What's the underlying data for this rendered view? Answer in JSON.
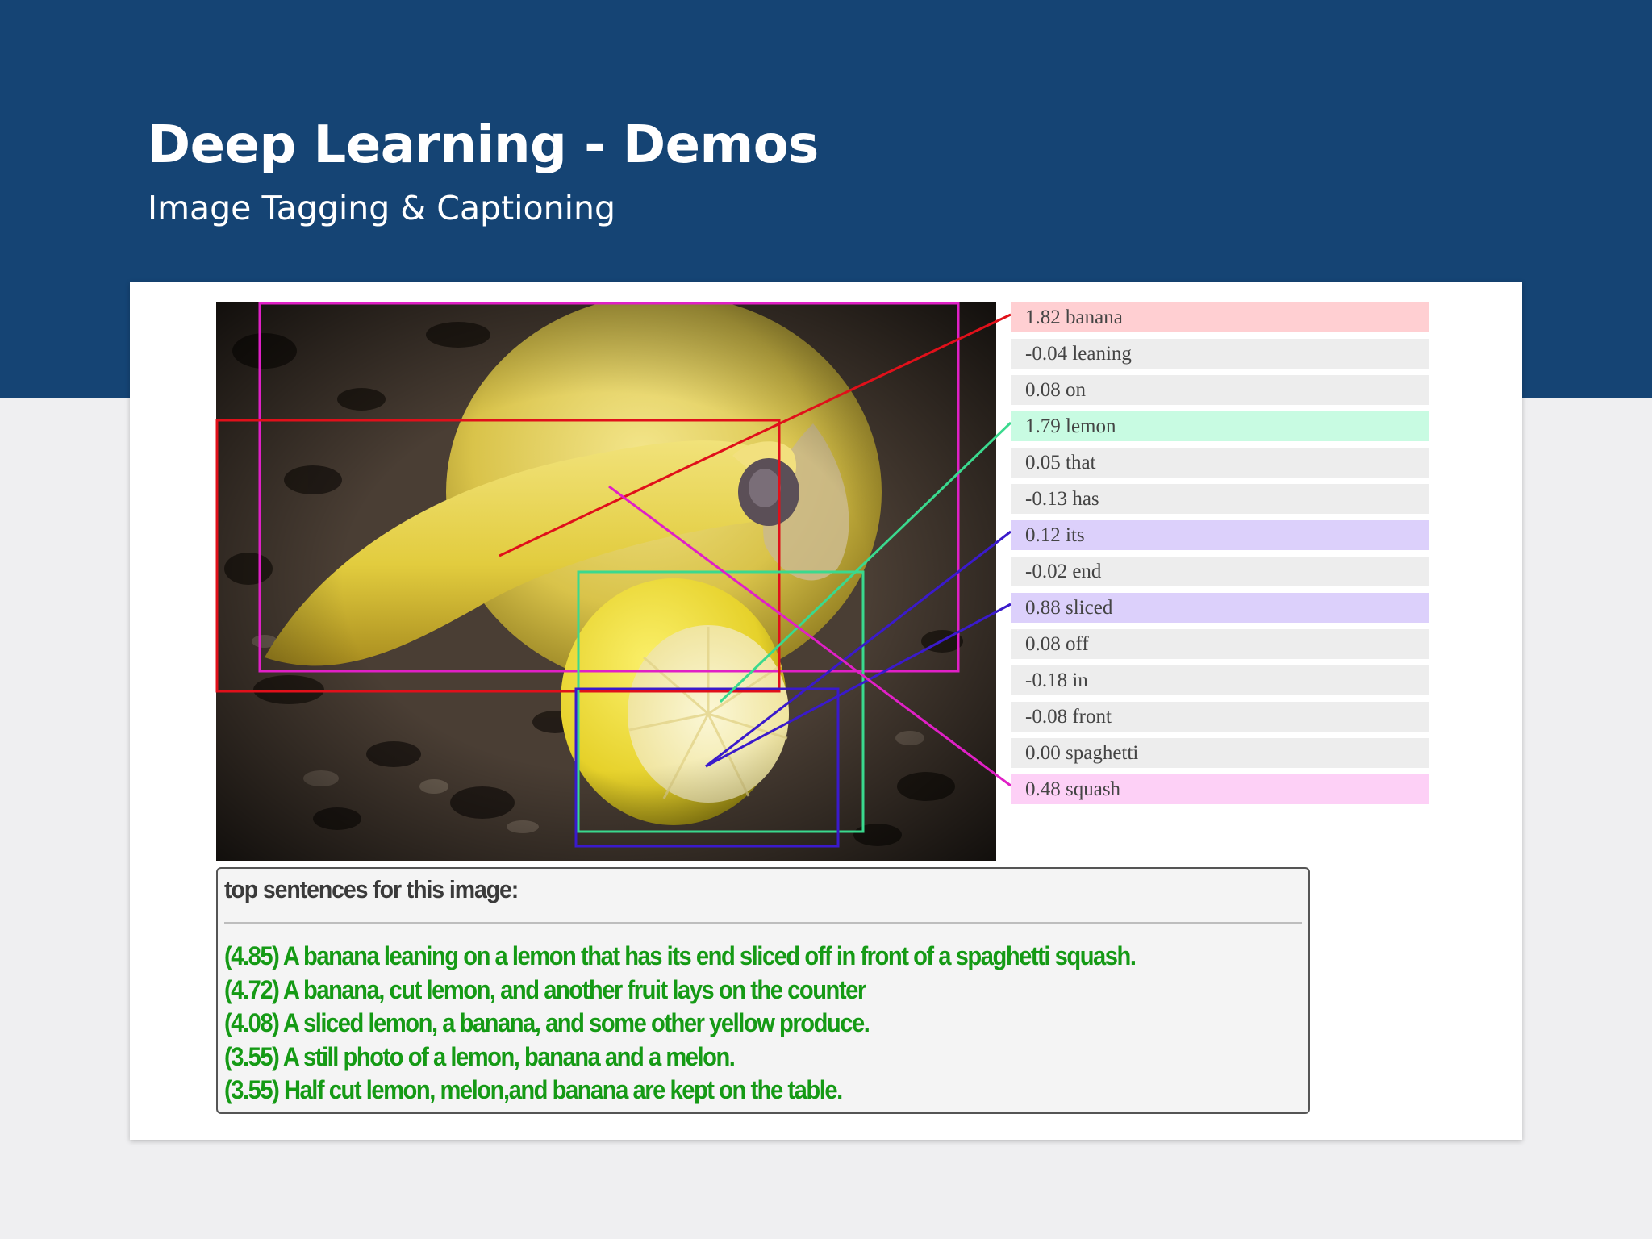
{
  "slide": {
    "title": "Deep Learning - Demos",
    "subtitle": "Image Tagging & Captioning"
  },
  "colors": {
    "banner": "#154474",
    "banana": "#e0101a",
    "lemon": "#3ad98e",
    "sliced": "#3a1acb",
    "squash": "#e020c6"
  },
  "tags": [
    {
      "score": "1.82",
      "word": "banana",
      "highlight": "#ffcfd2",
      "box": "banana"
    },
    {
      "score": "-0.04",
      "word": "leaning",
      "highlight": null
    },
    {
      "score": "0.08",
      "word": "on",
      "highlight": null
    },
    {
      "score": "1.79",
      "word": "lemon",
      "highlight": "#c8fbe2",
      "box": "lemon"
    },
    {
      "score": "0.05",
      "word": "that",
      "highlight": null
    },
    {
      "score": "-0.13",
      "word": "has",
      "highlight": null
    },
    {
      "score": "0.12",
      "word": "its",
      "highlight": "#dcd0fb",
      "box": "sliced"
    },
    {
      "score": "-0.02",
      "word": "end",
      "highlight": null
    },
    {
      "score": "0.88",
      "word": "sliced",
      "highlight": "#dcd0fb",
      "box": "sliced"
    },
    {
      "score": "0.08",
      "word": "off",
      "highlight": null
    },
    {
      "score": "-0.18",
      "word": "in",
      "highlight": null
    },
    {
      "score": "-0.08",
      "word": "front",
      "highlight": null
    },
    {
      "score": "0.00",
      "word": "spaghetti",
      "highlight": null
    },
    {
      "score": "0.48",
      "word": "squash",
      "highlight": "#fdd0f6",
      "box": "squash"
    }
  ],
  "captions": {
    "heading": "top sentences for this image:",
    "sentences": [
      "(4.85) A banana leaning on a lemon that has its end sliced off in front of a spaghetti squash.",
      "(4.72) A banana, cut lemon, and another fruit lays on the counter",
      "(4.08) A sliced lemon, a banana, and some other yellow produce.",
      "(3.55) A still photo of a lemon, banana and a melon.",
      "(3.55) Half cut lemon, melon,and banana are kept on the table."
    ]
  }
}
